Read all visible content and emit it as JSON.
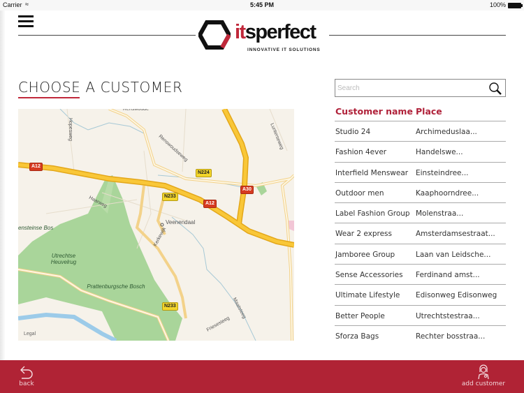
{
  "status_bar": {
    "carrier": "Carrier",
    "wifi_icon": "wifi-icon",
    "time": "5:45 PM",
    "battery": "100%"
  },
  "header": {
    "menu_icon": "hamburger-menu-icon",
    "logo": {
      "prefix": "it",
      "name": "sperfect",
      "tagline": "INNOVATIVE IT SOLUTIONS"
    }
  },
  "main": {
    "title": "CHOOSE A CUSTOMER",
    "map": {
      "place_labels": [
        "Renswoude",
        "Hopesweg",
        "Renswoudseweg",
        "Lunterseweg",
        "Haarweg",
        "Veenendaal",
        "Kerkewijk",
        "Utrechtse Heuvelrug",
        "Prattenburgsche Bosch",
        "Maatsteeg",
        "Friesesteeg",
        "ensteinse Bos"
      ],
      "road_shields": [
        {
          "label": "A12",
          "type": "motorway"
        },
        {
          "label": "N224",
          "type": "national"
        },
        {
          "label": "N233",
          "type": "national"
        },
        {
          "label": "A30",
          "type": "motorway"
        },
        {
          "label": "A12",
          "type": "motorway"
        },
        {
          "label": "N233",
          "type": "national"
        }
      ],
      "legal": "Legal"
    }
  },
  "search": {
    "placeholder": "Search",
    "value": "",
    "icon": "magnifier-icon"
  },
  "customers": {
    "headers": {
      "name": "Customer name",
      "place": "Place"
    },
    "rows": [
      {
        "name": "Studio 24",
        "place": "Archimeduslaa..."
      },
      {
        "name": "Fashion 4ever",
        "place": "Handelswe..."
      },
      {
        "name": "Interfield Menswear",
        "place": "Einsteindree..."
      },
      {
        "name": "Outdoor men",
        "place": "Kaaphoorndree..."
      },
      {
        "name": "Label Fashion Group",
        "place": "Molenstraa..."
      },
      {
        "name": "Wear 2 express",
        "place": "Amsterdamsestraat..."
      },
      {
        "name": "Jamboree Group",
        "place": "Laan van Leidsche..."
      },
      {
        "name": "Sense Accessories",
        "place": "Ferdinand amst..."
      },
      {
        "name": "Ultimate Lifestyle",
        "place": "Edisonweg Edisonweg"
      },
      {
        "name": "Better People",
        "place": "Utrechtstestraa..."
      },
      {
        "name": "Sforza Bags",
        "place": "Rechter bosstraa..."
      }
    ]
  },
  "footer": {
    "back_label": "back",
    "add_label": "add customer"
  },
  "colors": {
    "brand_red": "#b02335",
    "accent_red": "#c0283a"
  }
}
